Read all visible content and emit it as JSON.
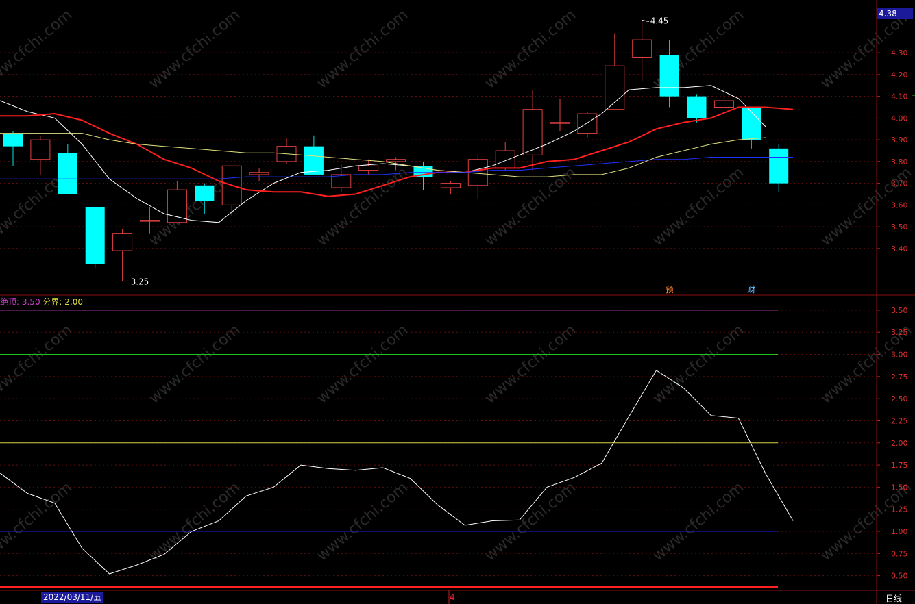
{
  "chart_data": [
    {
      "type": "candlestick",
      "panel": "price",
      "ylim": [
        3.22,
        4.48
      ],
      "y_ticks": [
        "4.30",
        "4.20",
        "4.10",
        "4.00",
        "3.90",
        "3.80",
        "3.70",
        "3.60",
        "3.50",
        "3.40"
      ],
      "candles": [
        {
          "o": 3.93,
          "c": 3.87,
          "h": 3.94,
          "l": 3.78
        },
        {
          "o": 3.81,
          "c": 3.9,
          "h": 3.92,
          "l": 3.74
        },
        {
          "o": 3.84,
          "c": 3.65,
          "h": 3.88,
          "l": 3.65
        },
        {
          "o": 3.59,
          "c": 3.33,
          "h": 3.59,
          "l": 3.31
        },
        {
          "o": 3.39,
          "c": 3.47,
          "h": 3.49,
          "l": 3.25
        },
        {
          "o": 3.53,
          "c": 3.53,
          "h": 3.59,
          "l": 3.47
        },
        {
          "o": 3.52,
          "c": 3.67,
          "h": 3.71,
          "l": 3.52
        },
        {
          "o": 3.69,
          "c": 3.62,
          "h": 3.7,
          "l": 3.56
        },
        {
          "o": 3.6,
          "c": 3.78,
          "h": 3.78,
          "l": 3.55
        },
        {
          "o": 3.74,
          "c": 3.75,
          "h": 3.77,
          "l": 3.71
        },
        {
          "o": 3.8,
          "c": 3.87,
          "h": 3.91,
          "l": 3.79
        },
        {
          "o": 3.87,
          "c": 3.74,
          "h": 3.92,
          "l": 3.74
        },
        {
          "o": 3.68,
          "c": 3.74,
          "h": 3.79,
          "l": 3.66
        },
        {
          "o": 3.76,
          "c": 3.78,
          "h": 3.81,
          "l": 3.74
        },
        {
          "o": 3.8,
          "c": 3.81,
          "h": 3.82,
          "l": 3.76
        },
        {
          "o": 3.78,
          "c": 3.73,
          "h": 3.8,
          "l": 3.67
        },
        {
          "o": 3.68,
          "c": 3.7,
          "h": 3.71,
          "l": 3.65
        },
        {
          "o": 3.69,
          "c": 3.81,
          "h": 3.83,
          "l": 3.63
        },
        {
          "o": 3.77,
          "c": 3.85,
          "h": 3.89,
          "l": 3.76
        },
        {
          "o": 3.83,
          "c": 4.04,
          "h": 4.13,
          "l": 3.76
        },
        {
          "o": 3.98,
          "c": 3.98,
          "h": 4.09,
          "l": 3.94
        },
        {
          "o": 3.93,
          "c": 4.02,
          "h": 4.03,
          "l": 3.91
        },
        {
          "o": 4.04,
          "c": 4.24,
          "h": 4.39,
          "l": 4.04
        },
        {
          "o": 4.28,
          "c": 4.36,
          "h": 4.45,
          "l": 4.17
        },
        {
          "o": 4.29,
          "c": 4.1,
          "h": 4.36,
          "l": 4.05
        },
        {
          "o": 4.1,
          "c": 4.0,
          "h": 4.11,
          "l": 3.98
        },
        {
          "o": 4.05,
          "c": 4.08,
          "h": 4.14,
          "l": 4.05
        },
        {
          "o": 4.05,
          "c": 3.9,
          "h": 4.05,
          "l": 3.86
        },
        {
          "o": 3.86,
          "c": 3.7,
          "h": 3.88,
          "l": 3.66
        }
      ],
      "ma_series": [
        {
          "color": "#ffffff",
          "values": [
            4.08,
            4.03,
            4.0,
            3.88,
            3.72,
            3.63,
            3.56,
            3.53,
            3.52,
            3.62,
            3.7,
            3.75,
            3.76,
            3.78,
            3.79,
            3.78,
            3.76,
            3.75,
            3.78,
            3.83,
            3.88,
            3.94,
            4.02,
            4.13,
            4.14,
            4.14,
            4.15,
            4.09,
            3.96
          ]
        },
        {
          "color": "#ff2020",
          "values": [
            4.01,
            4.01,
            4.02,
            3.99,
            3.93,
            3.88,
            3.81,
            3.77,
            3.71,
            3.67,
            3.66,
            3.66,
            3.64,
            3.65,
            3.69,
            3.73,
            3.75,
            3.75,
            3.77,
            3.77,
            3.8,
            3.81,
            3.85,
            3.89,
            3.95,
            3.98,
            4.0,
            4.05,
            4.05,
            4.04
          ]
        },
        {
          "color": "#e0e080",
          "values": [
            3.93,
            3.93,
            3.93,
            3.93,
            3.9,
            3.88,
            3.87,
            3.86,
            3.85,
            3.84,
            3.84,
            3.83,
            3.82,
            3.81,
            3.8,
            3.78,
            3.76,
            3.75,
            3.74,
            3.73,
            3.73,
            3.74,
            3.74,
            3.77,
            3.82,
            3.85,
            3.88,
            3.9,
            3.91
          ]
        },
        {
          "color": "#2030ff",
          "values": [
            3.72,
            3.72,
            3.72,
            3.72,
            3.72,
            3.72,
            3.72,
            3.72,
            3.72,
            3.73,
            3.73,
            3.73,
            3.73,
            3.74,
            3.74,
            3.75,
            3.75,
            3.75,
            3.76,
            3.76,
            3.77,
            3.78,
            3.79,
            3.8,
            3.81,
            3.81,
            3.82,
            3.82,
            3.82,
            3.82
          ]
        }
      ],
      "annotations": [
        {
          "text": "4.45",
          "candle": 23,
          "price": 4.45
        },
        {
          "text": "3.25",
          "candle": 4,
          "price": 3.25
        },
        {
          "text": "预",
          "candle": 24
        },
        {
          "text": "财",
          "candle": 27
        }
      ],
      "current_price": "4.38"
    },
    {
      "type": "line",
      "panel": "indicator",
      "ylim": [
        0.35,
        3.6
      ],
      "y_ticks": [
        "3.50",
        "3.25",
        "3.00",
        "2.75",
        "2.50",
        "2.25",
        "2.00",
        "1.75",
        "1.50",
        "1.25",
        "1.00",
        "0.75",
        "0.50"
      ],
      "series": [
        {
          "color": "#ffffff",
          "values": [
            1.66,
            1.43,
            1.32,
            0.81,
            0.52,
            0.62,
            0.74,
            1.0,
            1.12,
            1.4,
            1.5,
            1.75,
            1.71,
            1.69,
            1.72,
            1.6,
            1.3,
            1.07,
            1.12,
            1.13,
            1.5,
            1.61,
            1.77,
            2.3,
            2.82,
            2.62,
            2.31,
            2.28,
            1.65,
            1.12
          ]
        }
      ],
      "ref_lines": [
        {
          "value": 3.5,
          "color": "#c040c0"
        },
        {
          "value": 3.0,
          "color": "#20c020"
        },
        {
          "value": 2.0,
          "color": "#d0d040"
        },
        {
          "value": 1.0,
          "color": "#2020e0"
        },
        {
          "value": 0.4,
          "color": "#ff2020"
        }
      ],
      "legend": {
        "top_label": "绝顶: 3.50",
        "split_label": "分界: 2.00"
      }
    }
  ],
  "footer": {
    "date": "2022/03/11/五",
    "mid_label": "4",
    "period": "日线"
  },
  "watermark": "www.cfchi.com"
}
